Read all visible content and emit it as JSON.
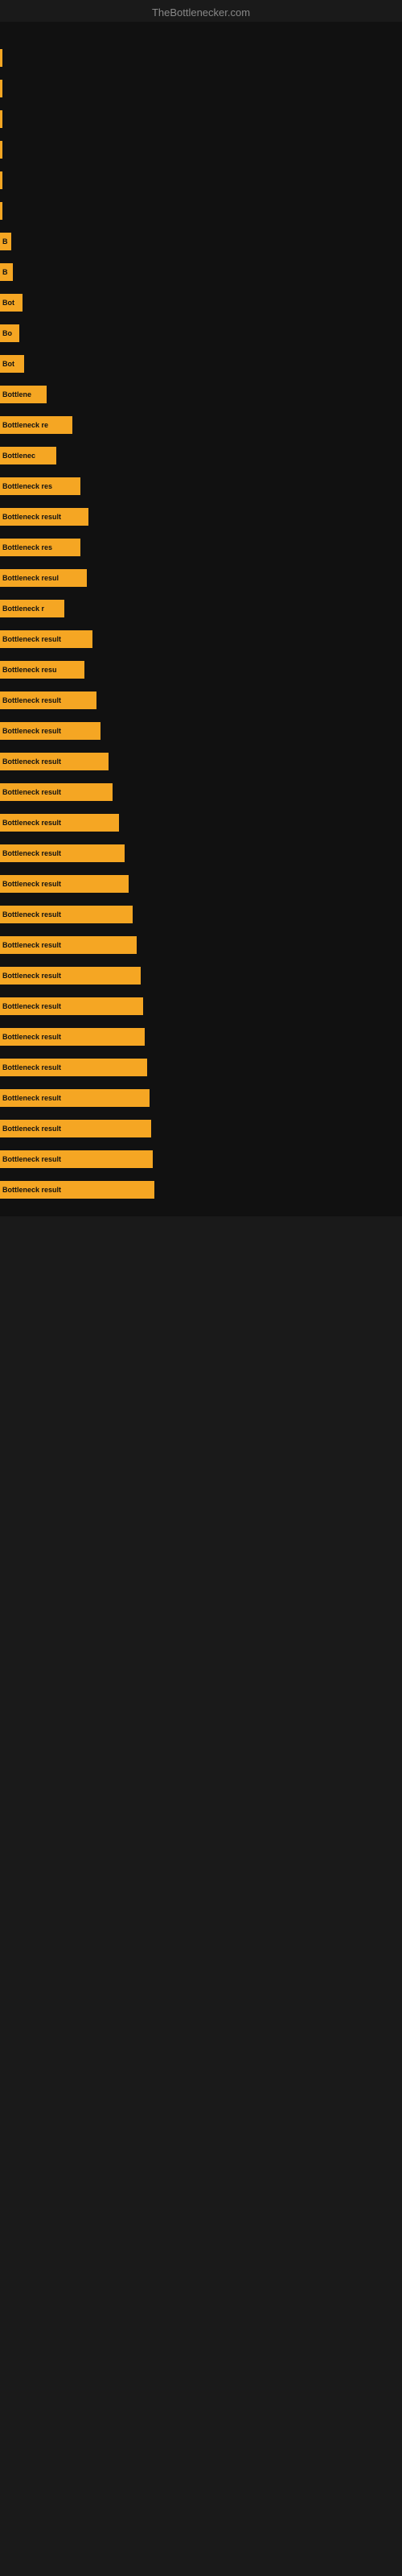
{
  "site": {
    "title": "TheBottlenecker.com"
  },
  "chart": {
    "background": "#111111"
  },
  "bars": [
    {
      "label": "",
      "width": 2
    },
    {
      "label": "",
      "width": 2
    },
    {
      "label": "",
      "width": 3
    },
    {
      "label": "",
      "width": 2
    },
    {
      "label": "",
      "width": 2
    },
    {
      "label": "",
      "width": 3
    },
    {
      "label": "B",
      "width": 14
    },
    {
      "label": "B",
      "width": 16
    },
    {
      "label": "Bot",
      "width": 28
    },
    {
      "label": "Bo",
      "width": 24
    },
    {
      "label": "Bot",
      "width": 30
    },
    {
      "label": "Bottlene",
      "width": 58
    },
    {
      "label": "Bottleneck re",
      "width": 90
    },
    {
      "label": "Bottlenec",
      "width": 70
    },
    {
      "label": "Bottleneck res",
      "width": 100
    },
    {
      "label": "Bottleneck result",
      "width": 110
    },
    {
      "label": "Bottleneck res",
      "width": 100
    },
    {
      "label": "Bottleneck resul",
      "width": 108
    },
    {
      "label": "Bottleneck r",
      "width": 80
    },
    {
      "label": "Bottleneck result",
      "width": 115
    },
    {
      "label": "Bottleneck resu",
      "width": 105
    },
    {
      "label": "Bottleneck result",
      "width": 120
    },
    {
      "label": "Bottleneck result",
      "width": 125
    },
    {
      "label": "Bottleneck result",
      "width": 135
    },
    {
      "label": "Bottleneck result",
      "width": 140
    },
    {
      "label": "Bottleneck result",
      "width": 148
    },
    {
      "label": "Bottleneck result",
      "width": 155
    },
    {
      "label": "Bottleneck result",
      "width": 160
    },
    {
      "label": "Bottleneck result",
      "width": 165
    },
    {
      "label": "Bottleneck result",
      "width": 170
    },
    {
      "label": "Bottleneck result",
      "width": 175
    },
    {
      "label": "Bottleneck result",
      "width": 178
    },
    {
      "label": "Bottleneck result",
      "width": 180
    },
    {
      "label": "Bottleneck result",
      "width": 183
    },
    {
      "label": "Bottleneck result",
      "width": 186
    },
    {
      "label": "Bottleneck result",
      "width": 188
    },
    {
      "label": "Bottleneck result",
      "width": 190
    },
    {
      "label": "Bottleneck result",
      "width": 192
    }
  ],
  "labels": {
    "bottleneck_result": "Bottleneck result"
  }
}
